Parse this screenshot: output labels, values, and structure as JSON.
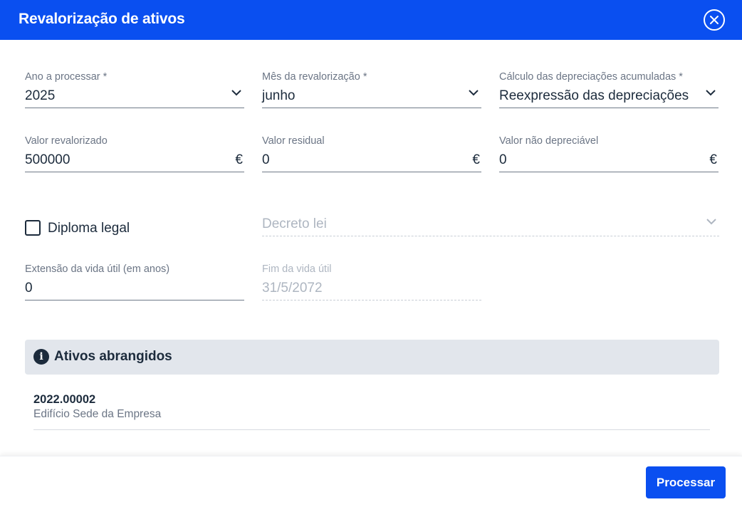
{
  "dialog": {
    "title": "Revalorização de ativos",
    "close_icon": "close-circle-icon"
  },
  "form": {
    "year": {
      "label": "Ano a processar *",
      "value": "2025"
    },
    "month": {
      "label": "Mês da revalorização *",
      "value": "junho"
    },
    "depreciation_calc": {
      "label": "Cálculo das depreciações acumuladas *",
      "value": "Reexpressão das depreciações"
    },
    "revalued_value": {
      "label": "Valor revalorizado",
      "value": "500000",
      "currency": "€"
    },
    "residual_value": {
      "label": "Valor residual",
      "value": "0",
      "currency": "€"
    },
    "non_depreciable_value": {
      "label": "Valor não depreciável",
      "value": "0",
      "currency": "€"
    },
    "legal_diploma": {
      "label": "Diploma legal",
      "checked": false
    },
    "decree_law": {
      "placeholder": "Decreto lei",
      "disabled": true
    },
    "useful_life_extension": {
      "label": "Extensão da vida útil (em anos)",
      "value": "0"
    },
    "useful_life_end": {
      "label": "Fim da vida útil",
      "value": "31/5/2072",
      "disabled": true
    }
  },
  "assets_section": {
    "title": "Ativos abrangidos",
    "icon": "info-icon",
    "items": [
      {
        "code": "2022.00002",
        "name": "Edifício Sede da Empresa"
      }
    ]
  },
  "footer": {
    "process_label": "Processar"
  },
  "colors": {
    "primary": "#0a4ff0",
    "text": "#1c2b3c",
    "muted": "#6b7585",
    "section_bg": "#e2e6ec"
  }
}
